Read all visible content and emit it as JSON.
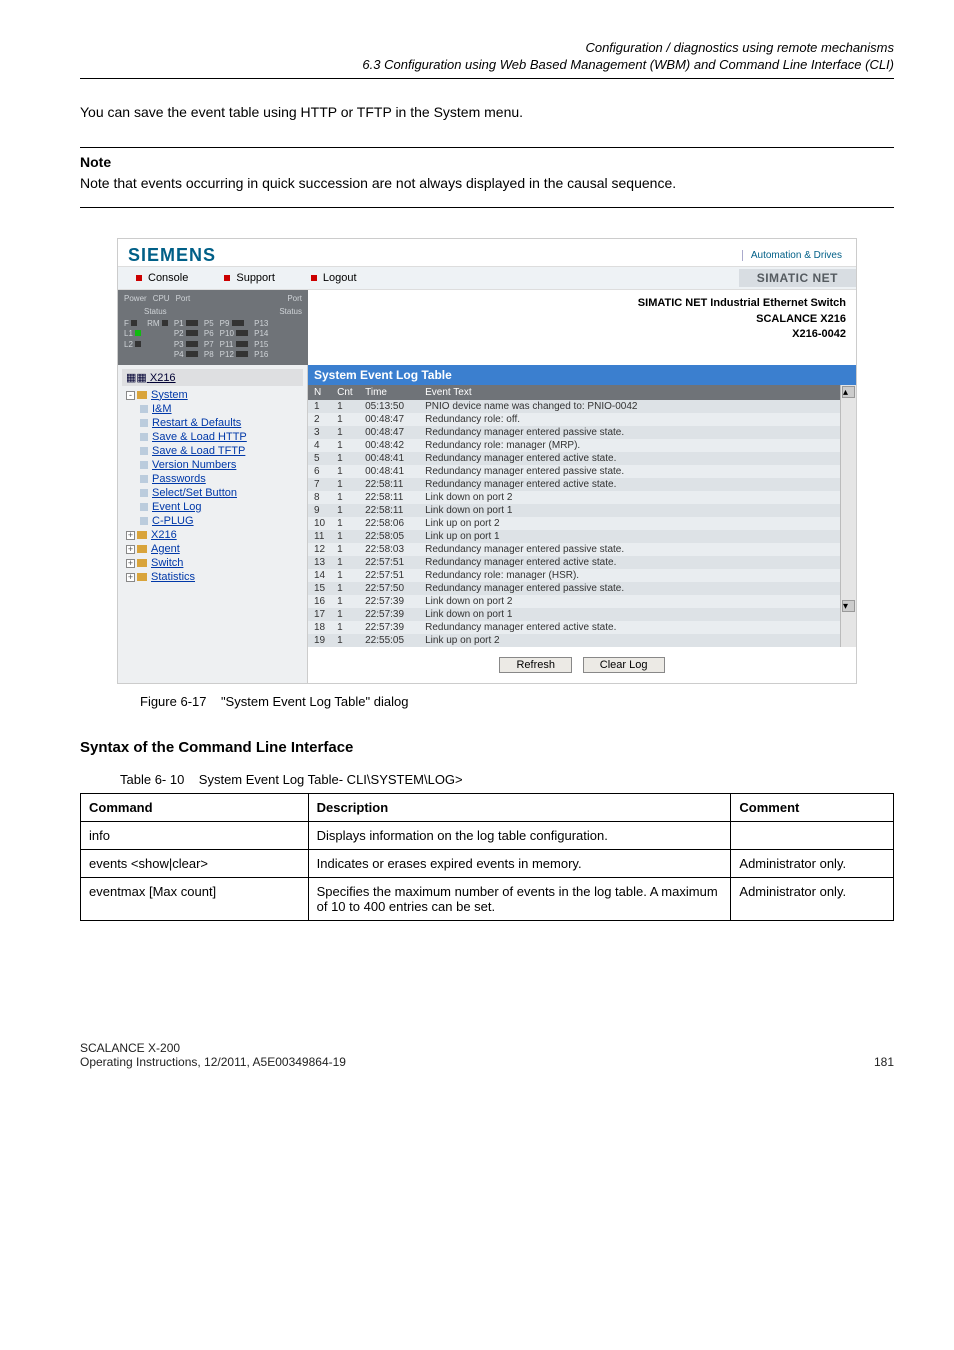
{
  "header": {
    "title_line": "Configuration / diagnostics using remote mechanisms",
    "section_line": "6.3 Configuration using Web Based Management (WBM) and Command Line Interface (CLI)"
  },
  "intro_text": "You can save the event table using HTTP or TFTP in the System menu.",
  "note": {
    "label": "Note",
    "text": "Note that events occurring in quick succession are not always displayed in the causal sequence."
  },
  "screenshot": {
    "siemens": "SIEMENS",
    "automation_drives": "Automation & Drives",
    "menu": {
      "console": "Console",
      "support": "Support",
      "logout": "Logout"
    },
    "simatic_net": "SIMATIC NET",
    "device_right": {
      "l1": "SIMATIC NET Industrial Ethernet Switch",
      "l2": "SCALANCE X216",
      "l3": "X216-0042"
    },
    "device_panel": {
      "power": "Power",
      "cpu": "CPU",
      "port": "Port",
      "status": "Status",
      "port2": "Port",
      "status2": "Status",
      "f": "F",
      "l1": "L1",
      "l2": "L2",
      "rm": "RM",
      "p1": "P1",
      "p2": "P2",
      "p3": "P3",
      "p4": "P4",
      "p5": "P5",
      "p6": "P6",
      "p7": "P7",
      "p8": "P8",
      "p9": "P9",
      "p10": "P10",
      "p11": "P11",
      "p12": "P12",
      "p13": "P13",
      "p14": "P14",
      "p15": "P15",
      "p16": "P16"
    },
    "tree": {
      "root": "X216",
      "system": "System",
      "items": [
        "I&M",
        "Restart & Defaults",
        "Save & Load HTTP",
        "Save & Load TFTP",
        "Version Numbers",
        "Passwords",
        "Select/Set Button",
        "Event Log",
        "C-PLUG"
      ],
      "folders": [
        "X216",
        "Agent",
        "Switch",
        "Statistics"
      ]
    },
    "log": {
      "title": "System Event Log Table",
      "cols": {
        "n": "N",
        "cnt": "Cnt",
        "time": "Time",
        "event": "Event Text"
      },
      "rows": [
        {
          "n": "1",
          "cnt": "1",
          "time": "05:13:50",
          "text": "PNIO device name was changed to: PNIO-0042"
        },
        {
          "n": "2",
          "cnt": "1",
          "time": "00:48:47",
          "text": "Redundancy role: off."
        },
        {
          "n": "3",
          "cnt": "1",
          "time": "00:48:47",
          "text": "Redundancy manager entered passive state."
        },
        {
          "n": "4",
          "cnt": "1",
          "time": "00:48:42",
          "text": "Redundancy role: manager (MRP)."
        },
        {
          "n": "5",
          "cnt": "1",
          "time": "00:48:41",
          "text": "Redundancy manager entered active state."
        },
        {
          "n": "6",
          "cnt": "1",
          "time": "00:48:41",
          "text": "Redundancy manager entered passive state."
        },
        {
          "n": "7",
          "cnt": "1",
          "time": "22:58:11",
          "text": "Redundancy manager entered active state."
        },
        {
          "n": "8",
          "cnt": "1",
          "time": "22:58:11",
          "text": "Link down on port 2"
        },
        {
          "n": "9",
          "cnt": "1",
          "time": "22:58:11",
          "text": "Link down on port 1"
        },
        {
          "n": "10",
          "cnt": "1",
          "time": "22:58:06",
          "text": "Link up on port 2"
        },
        {
          "n": "11",
          "cnt": "1",
          "time": "22:58:05",
          "text": "Link up on port 1"
        },
        {
          "n": "12",
          "cnt": "1",
          "time": "22:58:03",
          "text": "Redundancy manager entered passive state."
        },
        {
          "n": "13",
          "cnt": "1",
          "time": "22:57:51",
          "text": "Redundancy manager entered active state."
        },
        {
          "n": "14",
          "cnt": "1",
          "time": "22:57:51",
          "text": "Redundancy role: manager (HSR)."
        },
        {
          "n": "15",
          "cnt": "1",
          "time": "22:57:50",
          "text": "Redundancy manager entered passive state."
        },
        {
          "n": "16",
          "cnt": "1",
          "time": "22:57:39",
          "text": "Link down on port 2"
        },
        {
          "n": "17",
          "cnt": "1",
          "time": "22:57:39",
          "text": "Link down on port 1"
        },
        {
          "n": "18",
          "cnt": "1",
          "time": "22:57:39",
          "text": "Redundancy manager entered active state."
        },
        {
          "n": "19",
          "cnt": "1",
          "time": "22:55:05",
          "text": "Link up on port 2"
        }
      ],
      "refresh": "Refresh",
      "clearlog": "Clear Log"
    }
  },
  "figure_caption": {
    "num": "Figure 6-17",
    "text": "\"System Event Log Table\" dialog"
  },
  "cli_section_title": "Syntax of the Command Line Interface",
  "table_caption": {
    "num": "Table 6- 10",
    "text": "System Event Log Table- CLI\\SYSTEM\\LOG>"
  },
  "cmd_table": {
    "headers": {
      "cmd": "Command",
      "desc": "Description",
      "comment": "Comment"
    },
    "rows": [
      {
        "cmd": "info",
        "desc": "Displays information on the log table configuration.",
        "comment": ""
      },
      {
        "cmd": "events <show|clear>",
        "desc": "Indicates or erases expired events in memory.",
        "comment": "Administrator only."
      },
      {
        "cmd": "eventmax [Max count]",
        "desc": "Specifies the maximum number of events in the log table. A maximum of 10 to 400 entries can be set.",
        "comment": "Administrator only."
      }
    ]
  },
  "footer": {
    "left1": "SCALANCE X-200",
    "left2": "Operating Instructions, 12/2011, A5E00349864-19",
    "pagenum": "181"
  }
}
